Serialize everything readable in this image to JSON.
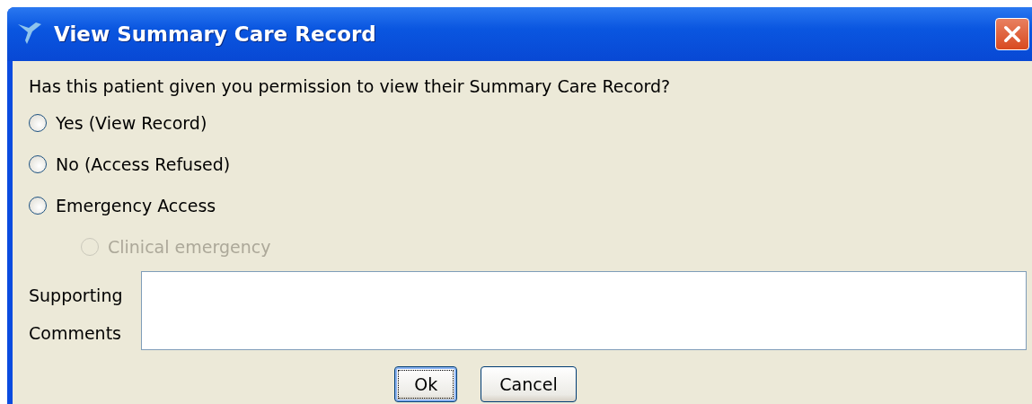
{
  "window": {
    "title": "View Summary Care Record"
  },
  "question": "Has this patient given you permission to view their Summary Care Record?",
  "options": [
    {
      "label": "Yes (View Record)",
      "selected": false,
      "disabled": false
    },
    {
      "label": "No (Access Refused)",
      "selected": false,
      "disabled": false
    },
    {
      "label": "Emergency Access",
      "selected": false,
      "disabled": false,
      "children": [
        {
          "label": "Clinical emergency",
          "selected": false,
          "disabled": true
        }
      ]
    }
  ],
  "comments": {
    "label_lines": [
      "Supporting",
      "Comments"
    ]
  },
  "buttons": [
    {
      "label": "Ok",
      "focused": true
    },
    {
      "label": "Cancel",
      "focused": false
    }
  ]
}
